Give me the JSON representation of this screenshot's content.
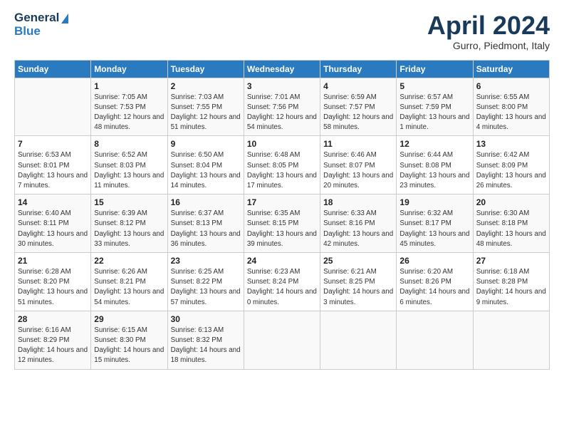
{
  "header": {
    "logo_line1": "General",
    "logo_line2": "Blue",
    "month": "April 2024",
    "location": "Gurro, Piedmont, Italy"
  },
  "weekdays": [
    "Sunday",
    "Monday",
    "Tuesday",
    "Wednesday",
    "Thursday",
    "Friday",
    "Saturday"
  ],
  "weeks": [
    [
      {
        "empty": true
      },
      {
        "day": 1,
        "sunrise": "7:05 AM",
        "sunset": "7:53 PM",
        "daylight": "12 hours and 48 minutes."
      },
      {
        "day": 2,
        "sunrise": "7:03 AM",
        "sunset": "7:55 PM",
        "daylight": "12 hours and 51 minutes."
      },
      {
        "day": 3,
        "sunrise": "7:01 AM",
        "sunset": "7:56 PM",
        "daylight": "12 hours and 54 minutes."
      },
      {
        "day": 4,
        "sunrise": "6:59 AM",
        "sunset": "7:57 PM",
        "daylight": "12 hours and 58 minutes."
      },
      {
        "day": 5,
        "sunrise": "6:57 AM",
        "sunset": "7:59 PM",
        "daylight": "13 hours and 1 minute."
      },
      {
        "day": 6,
        "sunrise": "6:55 AM",
        "sunset": "8:00 PM",
        "daylight": "13 hours and 4 minutes."
      }
    ],
    [
      {
        "day": 7,
        "sunrise": "6:53 AM",
        "sunset": "8:01 PM",
        "daylight": "13 hours and 7 minutes."
      },
      {
        "day": 8,
        "sunrise": "6:52 AM",
        "sunset": "8:03 PM",
        "daylight": "13 hours and 11 minutes."
      },
      {
        "day": 9,
        "sunrise": "6:50 AM",
        "sunset": "8:04 PM",
        "daylight": "13 hours and 14 minutes."
      },
      {
        "day": 10,
        "sunrise": "6:48 AM",
        "sunset": "8:05 PM",
        "daylight": "13 hours and 17 minutes."
      },
      {
        "day": 11,
        "sunrise": "6:46 AM",
        "sunset": "8:07 PM",
        "daylight": "13 hours and 20 minutes."
      },
      {
        "day": 12,
        "sunrise": "6:44 AM",
        "sunset": "8:08 PM",
        "daylight": "13 hours and 23 minutes."
      },
      {
        "day": 13,
        "sunrise": "6:42 AM",
        "sunset": "8:09 PM",
        "daylight": "13 hours and 26 minutes."
      }
    ],
    [
      {
        "day": 14,
        "sunrise": "6:40 AM",
        "sunset": "8:11 PM",
        "daylight": "13 hours and 30 minutes."
      },
      {
        "day": 15,
        "sunrise": "6:39 AM",
        "sunset": "8:12 PM",
        "daylight": "13 hours and 33 minutes."
      },
      {
        "day": 16,
        "sunrise": "6:37 AM",
        "sunset": "8:13 PM",
        "daylight": "13 hours and 36 minutes."
      },
      {
        "day": 17,
        "sunrise": "6:35 AM",
        "sunset": "8:15 PM",
        "daylight": "13 hours and 39 minutes."
      },
      {
        "day": 18,
        "sunrise": "6:33 AM",
        "sunset": "8:16 PM",
        "daylight": "13 hours and 42 minutes."
      },
      {
        "day": 19,
        "sunrise": "6:32 AM",
        "sunset": "8:17 PM",
        "daylight": "13 hours and 45 minutes."
      },
      {
        "day": 20,
        "sunrise": "6:30 AM",
        "sunset": "8:18 PM",
        "daylight": "13 hours and 48 minutes."
      }
    ],
    [
      {
        "day": 21,
        "sunrise": "6:28 AM",
        "sunset": "8:20 PM",
        "daylight": "13 hours and 51 minutes."
      },
      {
        "day": 22,
        "sunrise": "6:26 AM",
        "sunset": "8:21 PM",
        "daylight": "13 hours and 54 minutes."
      },
      {
        "day": 23,
        "sunrise": "6:25 AM",
        "sunset": "8:22 PM",
        "daylight": "13 hours and 57 minutes."
      },
      {
        "day": 24,
        "sunrise": "6:23 AM",
        "sunset": "8:24 PM",
        "daylight": "14 hours and 0 minutes."
      },
      {
        "day": 25,
        "sunrise": "6:21 AM",
        "sunset": "8:25 PM",
        "daylight": "14 hours and 3 minutes."
      },
      {
        "day": 26,
        "sunrise": "6:20 AM",
        "sunset": "8:26 PM",
        "daylight": "14 hours and 6 minutes."
      },
      {
        "day": 27,
        "sunrise": "6:18 AM",
        "sunset": "8:28 PM",
        "daylight": "14 hours and 9 minutes."
      }
    ],
    [
      {
        "day": 28,
        "sunrise": "6:16 AM",
        "sunset": "8:29 PM",
        "daylight": "14 hours and 12 minutes."
      },
      {
        "day": 29,
        "sunrise": "6:15 AM",
        "sunset": "8:30 PM",
        "daylight": "14 hours and 15 minutes."
      },
      {
        "day": 30,
        "sunrise": "6:13 AM",
        "sunset": "8:32 PM",
        "daylight": "14 hours and 18 minutes."
      },
      {
        "empty": true
      },
      {
        "empty": true
      },
      {
        "empty": true
      },
      {
        "empty": true
      }
    ]
  ],
  "labels": {
    "sunrise": "Sunrise:",
    "sunset": "Sunset:",
    "daylight": "Daylight:"
  }
}
